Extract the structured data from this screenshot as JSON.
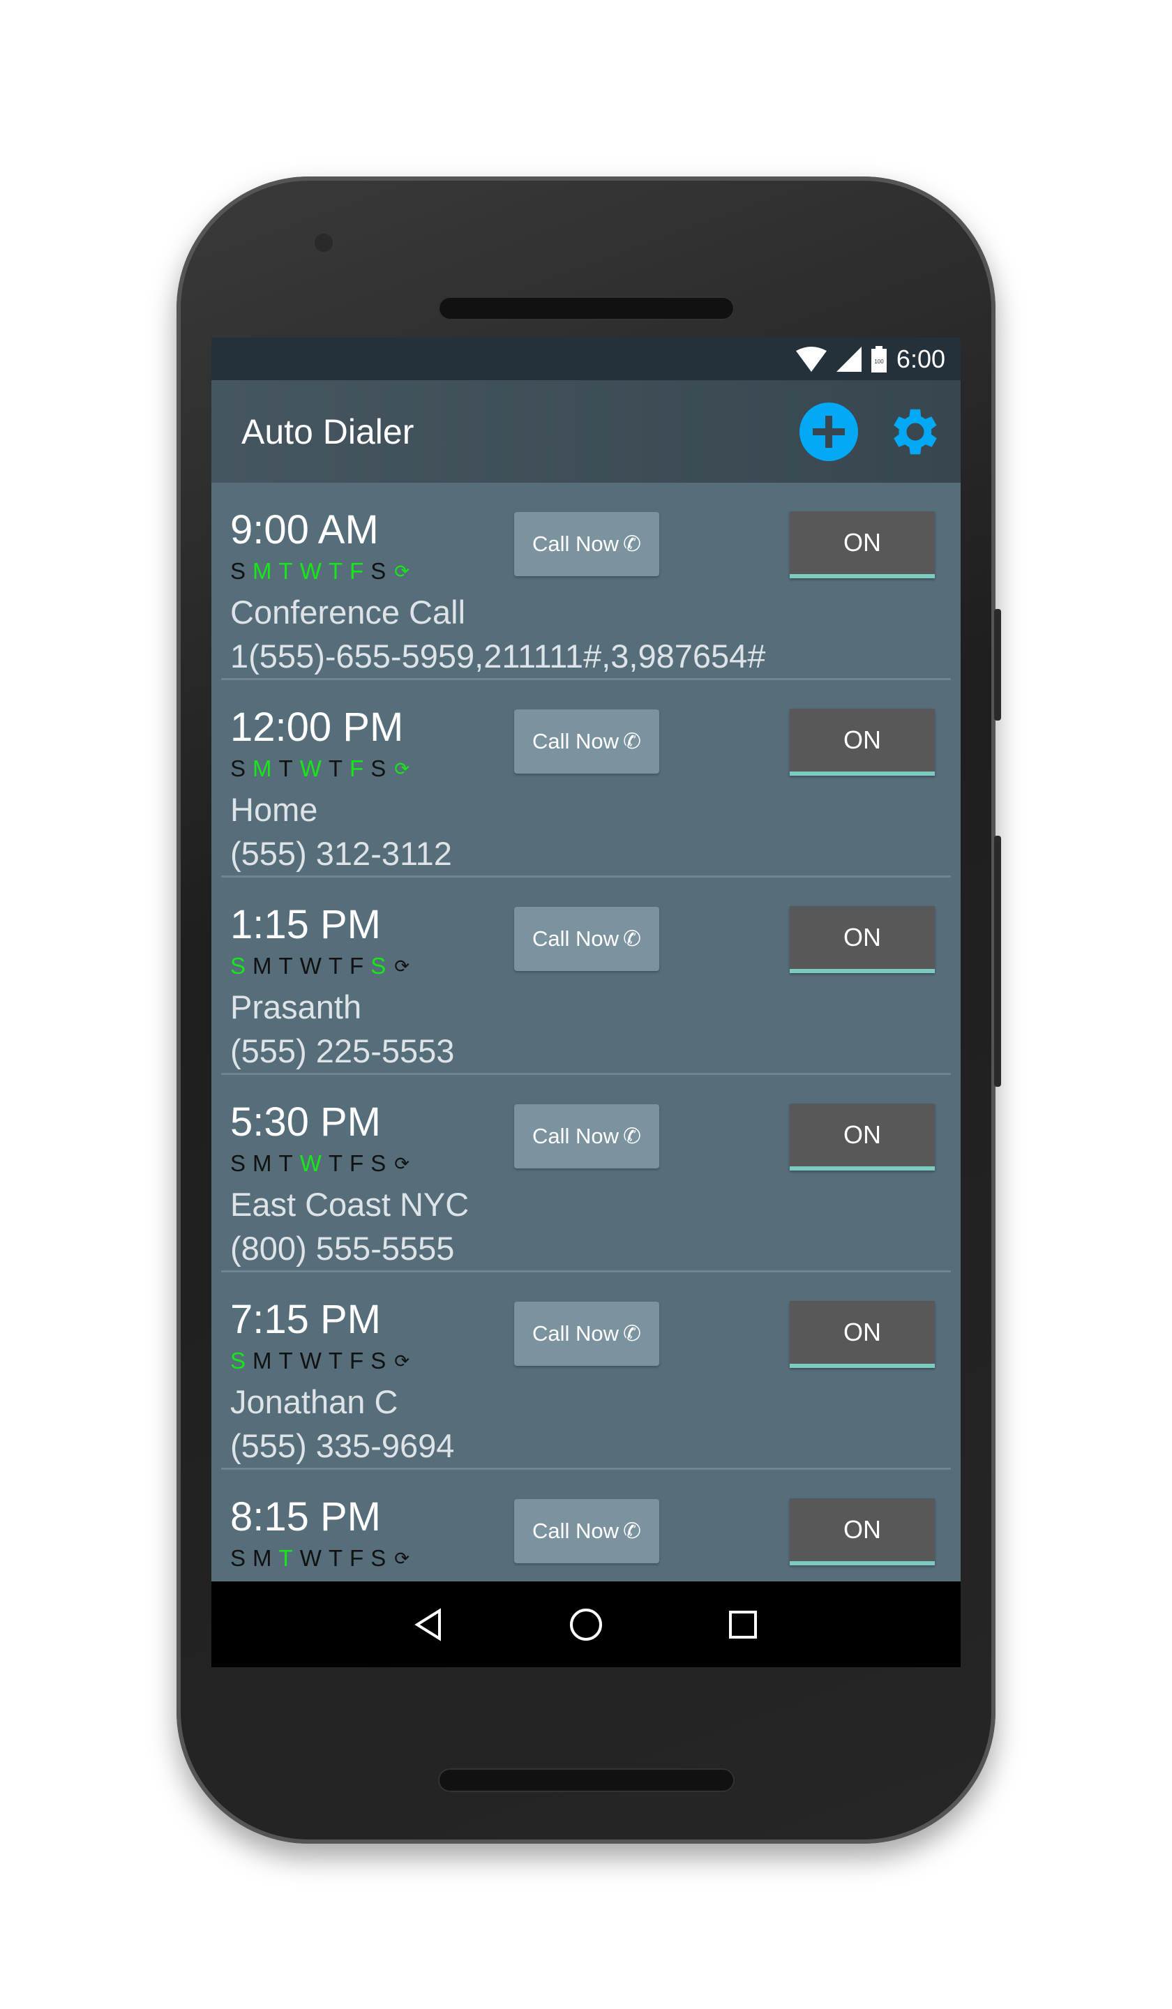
{
  "status_bar": {
    "time": "6:00",
    "battery_label": "100",
    "icons": [
      "wifi-icon",
      "signal-icon",
      "battery-icon"
    ]
  },
  "app_bar": {
    "title": "Auto Dialer",
    "add_icon": "add-circle-icon",
    "settings_icon": "gear-icon"
  },
  "colors": {
    "accent": "#03a9f4",
    "day_active": "#19e619",
    "toggle_underline": "#7ccbc0",
    "list_bg": "#566d7a"
  },
  "day_letters": [
    "S",
    "M",
    "T",
    "W",
    "T",
    "F",
    "S"
  ],
  "repeat_glyph": "⟳",
  "call_now_label": "Call Now",
  "call_icon": "✆",
  "items": [
    {
      "time": "9:00 AM",
      "days": [
        false,
        true,
        true,
        true,
        true,
        true,
        false
      ],
      "repeat": true,
      "name": "Conference Call",
      "number": "1(555)-655-5959,211111#,3,987654#",
      "toggle": "ON"
    },
    {
      "time": "12:00 PM",
      "days": [
        false,
        true,
        false,
        true,
        false,
        true,
        false
      ],
      "repeat": true,
      "name": "Home",
      "number": "(555) 312-3112",
      "toggle": "ON"
    },
    {
      "time": "1:15 PM",
      "days": [
        true,
        false,
        false,
        false,
        false,
        false,
        true
      ],
      "repeat": false,
      "name": "Prasanth",
      "number": "(555) 225-5553",
      "toggle": "ON"
    },
    {
      "time": "5:30 PM",
      "days": [
        false,
        false,
        false,
        true,
        false,
        false,
        false
      ],
      "repeat": false,
      "name": "East Coast NYC",
      "number": "(800) 555-5555",
      "toggle": "ON"
    },
    {
      "time": "7:15 PM",
      "days": [
        true,
        false,
        false,
        false,
        false,
        false,
        false
      ],
      "repeat": false,
      "name": "Jonathan C",
      "number": "(555) 335-9694",
      "toggle": "ON"
    },
    {
      "time": "8:15 PM",
      "days": [
        false,
        false,
        true,
        false,
        false,
        false,
        false
      ],
      "repeat": false,
      "name": "",
      "number": "",
      "toggle": "ON"
    }
  ],
  "nav_bar": {
    "icons": [
      "back-icon",
      "home-icon",
      "recents-icon"
    ]
  }
}
